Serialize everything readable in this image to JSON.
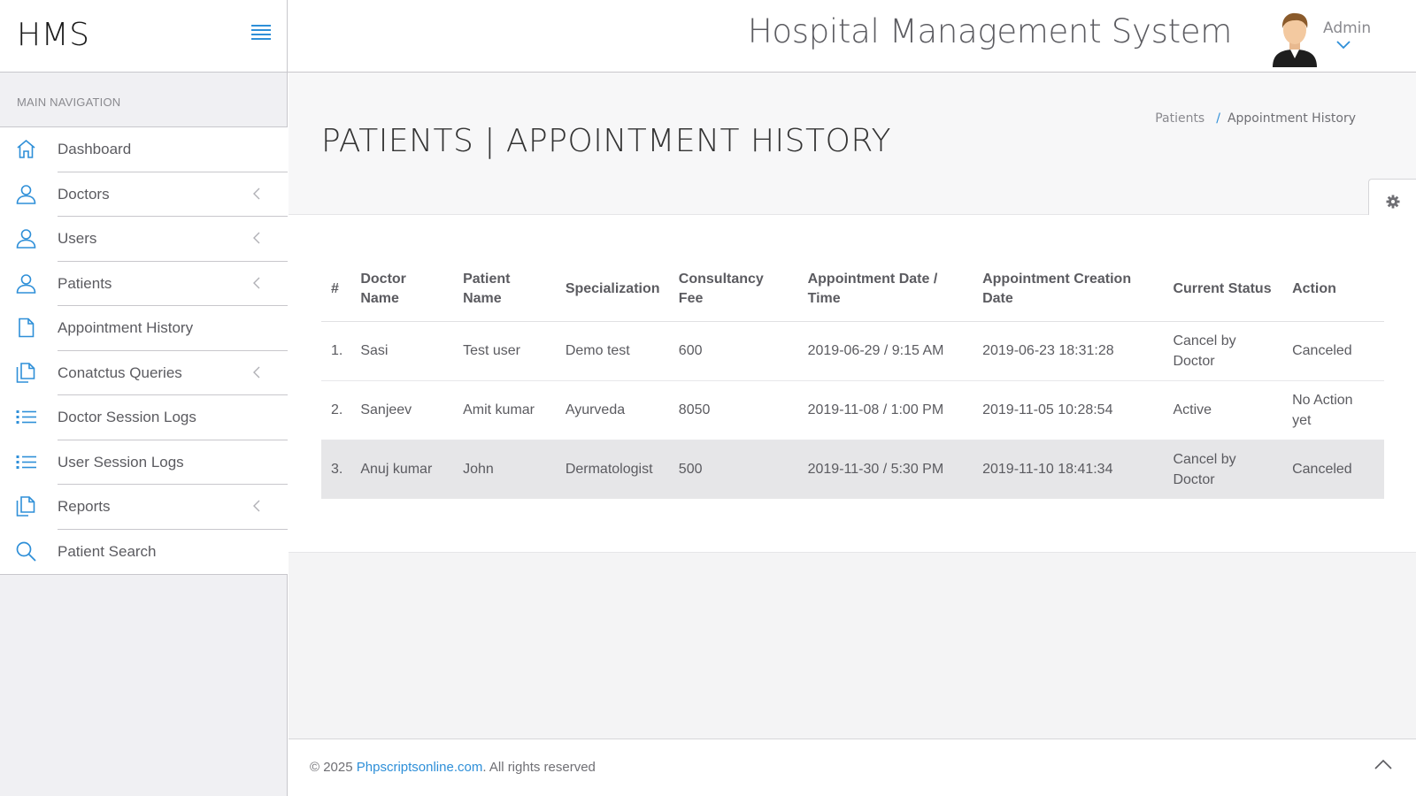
{
  "header": {
    "brand": "HMS",
    "app_title": "Hospital Management System",
    "user_name": "Admin"
  },
  "sidebar": {
    "heading": "MAIN NAVIGATION",
    "items": [
      {
        "label": "Dashboard",
        "icon": "home-icon",
        "has_submenu": false
      },
      {
        "label": "Doctors",
        "icon": "user-icon",
        "has_submenu": true
      },
      {
        "label": "Users",
        "icon": "user-icon",
        "has_submenu": true
      },
      {
        "label": "Patients",
        "icon": "user-icon",
        "has_submenu": true
      },
      {
        "label": "Appointment History",
        "icon": "file-icon",
        "has_submenu": false
      },
      {
        "label": "Conatctus Queries",
        "icon": "files-icon",
        "has_submenu": true
      },
      {
        "label": "Doctor Session Logs",
        "icon": "list-icon",
        "has_submenu": false
      },
      {
        "label": "User Session Logs",
        "icon": "list-icon",
        "has_submenu": false
      },
      {
        "label": "Reports",
        "icon": "files-icon",
        "has_submenu": true
      },
      {
        "label": "Patient Search",
        "icon": "search-icon",
        "has_submenu": false
      }
    ]
  },
  "page": {
    "title": "PATIENTS | APPOINTMENT HISTORY",
    "breadcrumb": [
      "Patients",
      "Appointment History"
    ]
  },
  "table": {
    "columns": [
      "#",
      "Doctor Name",
      "Patient Name",
      "Specialization",
      "Consultancy Fee",
      "Appointment Date / Time",
      "Appointment Creation Date",
      "Current Status",
      "Action"
    ],
    "rows": [
      [
        "1.",
        "Sasi",
        "Test user",
        "Demo test",
        "600",
        "2019-06-29 / 9:15 AM",
        "2019-06-23 18:31:28",
        "Cancel by Doctor",
        "Canceled"
      ],
      [
        "2.",
        "Sanjeev",
        "Amit kumar",
        "Ayurveda",
        "8050",
        "2019-11-08 / 1:00 PM",
        "2019-11-05 10:28:54",
        "Active",
        "No Action yet"
      ],
      [
        "3.",
        "Anuj kumar",
        "John",
        "Dermatologist",
        "500",
        "2019-11-30 / 5:30 PM",
        "2019-11-10 18:41:34",
        "Cancel by Doctor",
        "Canceled"
      ]
    ],
    "highlighted_row": 3
  },
  "footer": {
    "prefix": "© 2025 ",
    "link": "Phpscriptsonline.com",
    "suffix": ". All rights reserved"
  },
  "colors": {
    "accent": "#2e8fd8",
    "sidebar_bg": "#f0f0f3",
    "highlight_row": "#e6e6e8"
  }
}
